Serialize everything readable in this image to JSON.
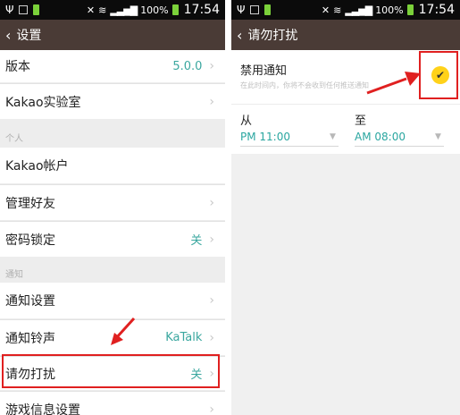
{
  "status": {
    "battery": "100%",
    "time": "17:54"
  },
  "left": {
    "title": "设置",
    "rows": {
      "version_label": "版本",
      "version_value": "5.0.0",
      "lab": "Kakao实验室",
      "section_personal": "个人",
      "account": "Kakao帐户",
      "friends": "管理好友",
      "passcode": "密码锁定",
      "passcode_value": "关",
      "section_notify": "通知",
      "notify_settings": "通知设置",
      "ringtone": "通知铃声",
      "ringtone_value": "KaTalk",
      "dnd": "请勿打扰",
      "dnd_value": "关",
      "game": "游戏信息设置"
    }
  },
  "right": {
    "title": "请勿打扰",
    "mute_label": "禁用通知",
    "mute_desc": "在此时间内，你将不会收到任何推送通知",
    "from_label": "从",
    "to_label": "至",
    "from_value": "PM 11:00",
    "to_value": "AM 08:00",
    "mute_checked": true
  },
  "colors": {
    "accent_teal": "#3aa79f",
    "titlebar_brown": "#4a3b36",
    "highlight_red": "#e02020",
    "check_yellow": "#ffd21a"
  }
}
